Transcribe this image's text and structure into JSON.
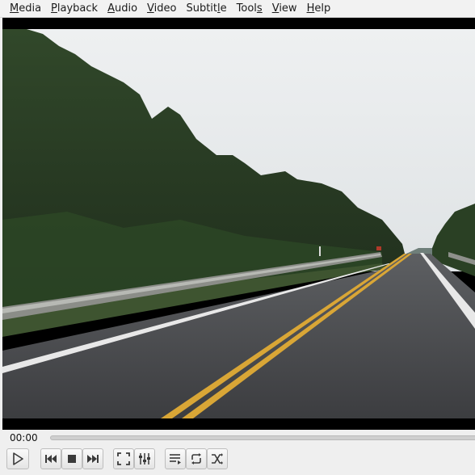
{
  "menu": {
    "items": [
      {
        "label": "Media"
      },
      {
        "label": "Playback"
      },
      {
        "label": "Audio"
      },
      {
        "label": "Video"
      },
      {
        "label": "Subtitle"
      },
      {
        "label": "Tools"
      },
      {
        "label": "View"
      },
      {
        "label": "Help"
      }
    ]
  },
  "player": {
    "elapsed_time": "00:00",
    "seek_position": 0
  },
  "controls": {
    "icons": [
      "play-icon",
      "previous-icon",
      "stop-icon",
      "next-icon",
      "fullscreen-icon",
      "extended-settings-icon",
      "playlist-icon",
      "loop-icon",
      "shuffle-icon"
    ]
  },
  "colors": {
    "menubar_bg": "#f2f2f2",
    "window_bg": "#efefef",
    "video_bg": "#000000"
  }
}
